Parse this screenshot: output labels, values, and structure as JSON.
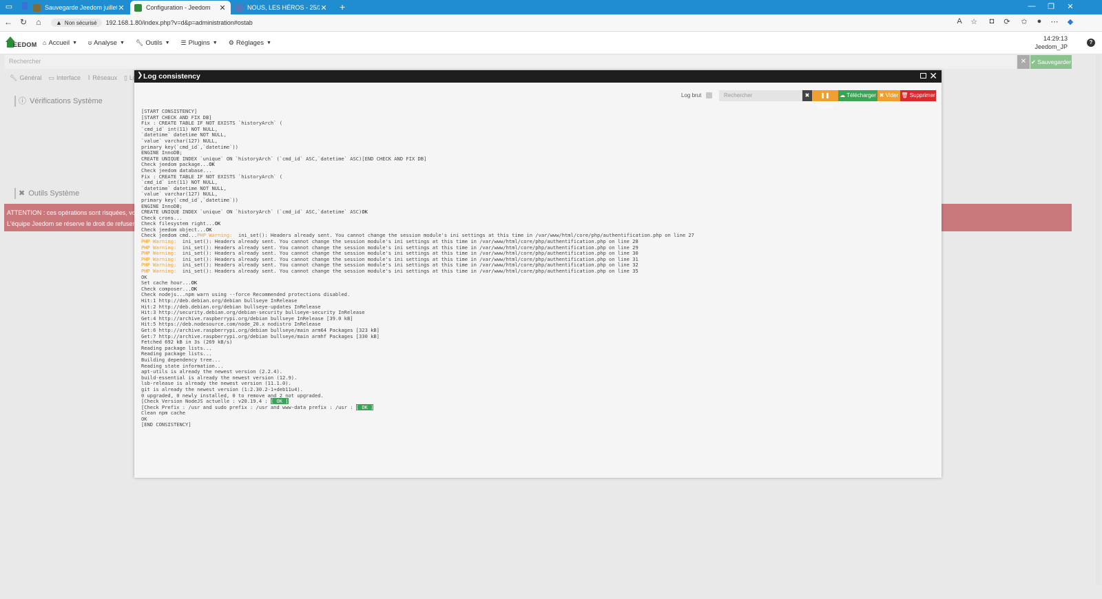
{
  "browser": {
    "tabs": [
      {
        "title": "Sauvegarde Jeedom juillet 2025 -",
        "active": false
      },
      {
        "title": "Configuration - Jeedom",
        "active": true
      },
      {
        "title": "NOUS, LES HÉROS - 25/26 - La C",
        "active": false
      }
    ],
    "security_label": "Non sécurisé",
    "url": "192.168.1.80/index.php?v=d&p=administration#ostab"
  },
  "navbar": {
    "logo_text": "EEDOM",
    "menu": [
      "Accueil",
      "Analyse",
      "Outils",
      "Plugins",
      "Réglages"
    ],
    "time": "14:29:13",
    "user": "Jeedom_JP"
  },
  "page": {
    "search_placeholder": "Rechercher",
    "save_label": "Sauvegarder",
    "subtabs": [
      "Général",
      "Interface",
      "Réseaux",
      "Lo"
    ],
    "section_verif": "Vérifications Système",
    "section_tools": "Outils Système",
    "alert_line1": "ATTENTION : ces opérations sont risquées, vous",
    "alert_line2": "L'équipe Jeedom se réserve le droit de refuser to"
  },
  "modal": {
    "title": "Log consistency",
    "log_brut_label": "Log brut",
    "search_placeholder": "Rechercher",
    "pause_label": "Pause",
    "download_label": "Télécharger",
    "clear_label": "Vider",
    "delete_label": "Supprimer",
    "log_lines": [
      "[START CONSISTENCY]",
      "[START CHECK AND FIX DB]",
      "Fix : CREATE TABLE IF NOT EXISTS `historyArch` (",
      "`cmd_id` int(11) NOT NULL,",
      "`datetime` datetime NOT NULL,",
      "`value` varchar(127) NULL,",
      "primary key(`cmd_id`,`datetime`))",
      "ENGINE InnoDB;",
      "CREATE UNIQUE INDEX `unique` ON `historyArch` (`cmd_id` ASC,`datetime` ASC)[END CHECK AND FIX DB]",
      "Check jeedom package...OK",
      "Check jeedom database...",
      "Fix : CREATE TABLE IF NOT EXISTS `historyArch` (",
      "`cmd_id` int(11) NOT NULL,",
      "`datetime` datetime NOT NULL,",
      "`value` varchar(127) NULL,",
      "primary key(`cmd_id`,`datetime`))",
      "ENGINE InnoDB;",
      "CREATE UNIQUE INDEX `unique` ON `historyArch` (`cmd_id` ASC,`datetime` ASC)OK",
      "Check crons...",
      "Check filesystem right...OK",
      "Check jeedom object...OK",
      "Check jeedom cmd...PHP Warning:  ini_set(): Headers already sent. You cannot change the session module's ini settings at this time in /var/www/html/core/php/authentification.php on line 27",
      "PHP Warning:  ini_set(): Headers already sent. You cannot change the session module's ini settings at this time in /var/www/html/core/php/authentification.php on line 28",
      "PHP Warning:  ini_set(): Headers already sent. You cannot change the session module's ini settings at this time in /var/www/html/core/php/authentification.php on line 29",
      "PHP Warning:  ini_set(): Headers already sent. You cannot change the session module's ini settings at this time in /var/www/html/core/php/authentification.php on line 30",
      "PHP Warning:  ini_set(): Headers already sent. You cannot change the session module's ini settings at this time in /var/www/html/core/php/authentification.php on line 31",
      "PHP Warning:  ini_set(): Headers already sent. You cannot change the session module's ini settings at this time in /var/www/html/core/php/authentification.php on line 32",
      "PHP Warning:  ini_set(): Headers already sent. You cannot change the session module's ini settings at this time in /var/www/html/core/php/authentification.php on line 35",
      "OK",
      "Set cache hour...OK",
      "Check composer...OK",
      "Check nodejs...npm warn using --force Recommended protections disabled.",
      "Hit:1 http://deb.debian.org/debian bullseye InRelease",
      "Hit:2 http://deb.debian.org/debian bullseye-updates InRelease",
      "Hit:3 http://security.debian.org/debian-security bullseye-security InRelease",
      "Get:4 http://archive.raspberrypi.org/debian bullseye InRelease [39.0 kB]",
      "Hit:5 https://deb.nodesource.com/node_20.x nodistro InRelease",
      "Get:6 http://archive.raspberrypi.org/debian bullseye/main arm64 Packages [323 kB]",
      "Get:7 http://archive.raspberrypi.org/debian bullseye/main armhf Packages [330 kB]",
      "Fetched 692 kB in 3s (269 kB/s)",
      "Reading package lists...",
      "Reading package lists...",
      "Building dependency tree...",
      "Reading state information...",
      "apt-utils is already the newest version (2.2.4).",
      "build-essential is already the newest version (12.9).",
      "lsb-release is already the newest version (11.1.0).",
      "git is already the newest version (1:2.30.2-1+deb11u4).",
      "0 upgraded, 0 newly installed, 0 to remove and 2 not upgraded.",
      "[Check Version NodeJS actuelle : v20.19.4 : [ OK ]",
      "[Check Prefix : /usr and sudo prefix : /usr and www-data prefix : /usr : [ OK ]",
      "Clean npm cache",
      "OK",
      "[END CONSISTENCY]"
    ]
  }
}
